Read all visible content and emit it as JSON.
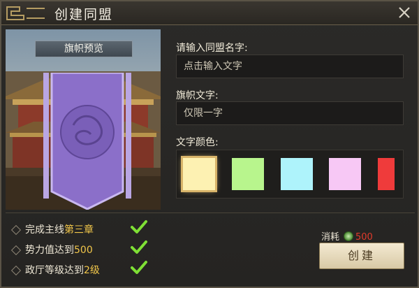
{
  "dialog": {
    "title": "创建同盟"
  },
  "preview": {
    "label": "旗帜预览"
  },
  "form": {
    "name_label": "请输入同盟名字:",
    "name_placeholder": "点击输入文字",
    "banner_text_label": "旗帜文字:",
    "banner_text_placeholder": "仅限一字",
    "color_label": "文字颜色:"
  },
  "colors": [
    {
      "name": "cream",
      "hex": "#fdf1b2",
      "selected": true
    },
    {
      "name": "green",
      "hex": "#b8f58d"
    },
    {
      "name": "cyan",
      "hex": "#aef3fb"
    },
    {
      "name": "pink",
      "hex": "#f7c8f5"
    },
    {
      "name": "red",
      "hex": "#ef3b3b"
    }
  ],
  "requirements": [
    {
      "text": "完成主线",
      "highlight": "第三章"
    },
    {
      "text": "势力值达到",
      "highlight": "500"
    },
    {
      "text": "政厅等级达到",
      "highlight": "2级"
    }
  ],
  "cost": {
    "label": "消耗",
    "amount": "500"
  },
  "actions": {
    "create_label": "创建"
  }
}
